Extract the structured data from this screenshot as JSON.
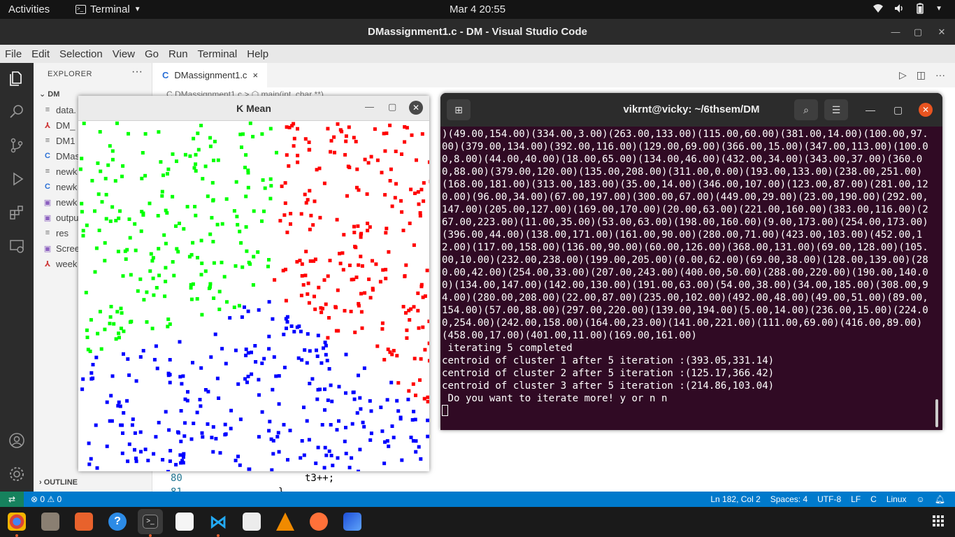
{
  "topbar": {
    "activities": "Activities",
    "app": "Terminal",
    "clock": "Mar 4  20:55"
  },
  "vscode": {
    "title": "DMassignment1.c - DM - Visual Studio Code",
    "menu": [
      "File",
      "Edit",
      "Selection",
      "View",
      "Go",
      "Run",
      "Terminal",
      "Help"
    ],
    "explorer": {
      "header": "EXPLORER",
      "folder": "DM",
      "files": [
        {
          "icon": "≡",
          "name": "data.",
          "color": "#6b6b6b"
        },
        {
          "icon": "⅄",
          "name": "DM_",
          "color": "#d04040"
        },
        {
          "icon": "≡",
          "name": "DM1",
          "color": "#6b6b6b"
        },
        {
          "icon": "C",
          "name": "DMas",
          "color": "#2a6fd6"
        },
        {
          "icon": "≡",
          "name": "newk",
          "color": "#6b6b6b"
        },
        {
          "icon": "C",
          "name": "newk",
          "color": "#2a6fd6"
        },
        {
          "icon": "▣",
          "name": "newk",
          "color": "#8b5fbf"
        },
        {
          "icon": "▣",
          "name": "outpu",
          "color": "#8b5fbf"
        },
        {
          "icon": "≡",
          "name": "res",
          "color": "#6b6b6b"
        },
        {
          "icon": "▣",
          "name": "Scree",
          "color": "#8b5fbf"
        },
        {
          "icon": "⅄",
          "name": "week",
          "color": "#d04040"
        }
      ],
      "outline": "OUTLINE"
    },
    "tab": {
      "icon": "C",
      "label": "DMassignment1.c",
      "close": "×"
    },
    "breadcrumb": "C DMassignment1.c > ⬡ main(int, char **)",
    "lines": [
      {
        "num": "80",
        "code": "t3++;"
      },
      {
        "num": "81",
        "code": "}"
      }
    ],
    "status": {
      "problems": "⊗ 0 ⚠ 0",
      "position": "Ln 182, Col 2",
      "spaces": "Spaces: 4",
      "encoding": "UTF-8",
      "eol": "LF",
      "lang": "C",
      "os": "Linux"
    }
  },
  "kmean": {
    "title": "K Mean"
  },
  "terminal": {
    "title": "vikrnt@vicky: ~/6thsem/DM",
    "output": ")(49.00,154.00)(334.00,3.00)(263.00,133.00)(115.00,60.00)(381.00,14.00)(100.00,97.00)(379.00,134.00)(392.00,116.00)(129.00,69.00)(366.00,15.00)(347.00,113.00)(100.00,8.00)(44.00,40.00)(18.00,65.00)(134.00,46.00)(432.00,34.00)(343.00,37.00)(360.00,88.00)(379.00,120.00)(135.00,208.00)(311.00,0.00)(193.00,133.00)(238.00,251.00)(168.00,181.00)(313.00,183.00)(35.00,14.00)(346.00,107.00)(123.00,87.00)(281.00,120.00)(96.00,34.00)(67.00,197.00)(300.00,67.00)(449.00,29.00)(23.00,190.00)(292.00,147.00)(205.00,127.00)(169.00,170.00)(20.00,63.00)(221.00,160.00)(383.00,116.00)(267.00,223.00)(11.00,35.00)(53.00,63.00)(198.00,160.00)(9.00,173.00)(254.00,173.00)(396.00,44.00)(138.00,171.00)(161.00,90.00)(280.00,71.00)(423.00,103.00)(452.00,12.00)(117.00,158.00)(136.00,90.00)(60.00,126.00)(368.00,131.00)(69.00,128.00)(105.00,10.00)(232.00,238.00)(199.00,205.00)(0.00,62.00)(69.00,38.00)(128.00,139.00)(280.00,42.00)(254.00,33.00)(207.00,243.00)(400.00,50.00)(288.00,220.00)(190.00,140.00)(134.00,147.00)(142.00,130.00)(191.00,63.00)(54.00,38.00)(34.00,185.00)(308.00,94.00)(280.00,208.00)(22.00,87.00)(235.00,102.00)(492.00,48.00)(49.00,51.00)(89.00,154.00)(57.00,88.00)(297.00,220.00)(139.00,194.00)(5.00,14.00)(236.00,15.00)(224.00,254.00)(242.00,158.00)(164.00,23.00)(141.00,221.00)(111.00,69.00)(416.00,89.00)(458.00,17.00)(401.00,11.00)(169.00,161.00)\n iterating 5 completed\ncentroid of cluster 1 after 5 iteration :(393.05,331.14)\ncentroid of cluster 2 after 5 iteration :(125.17,366.42)\ncentroid of cluster 3 after 5 iteration :(214.86,103.04)\n Do you want to iterate more! y or n n\n"
  },
  "colors": {
    "cluster1": "#ff0000",
    "cluster2": "#00ff00",
    "cluster3": "#0000ff",
    "terminal_bg": "#300a24",
    "statusbar": "#007acc"
  }
}
